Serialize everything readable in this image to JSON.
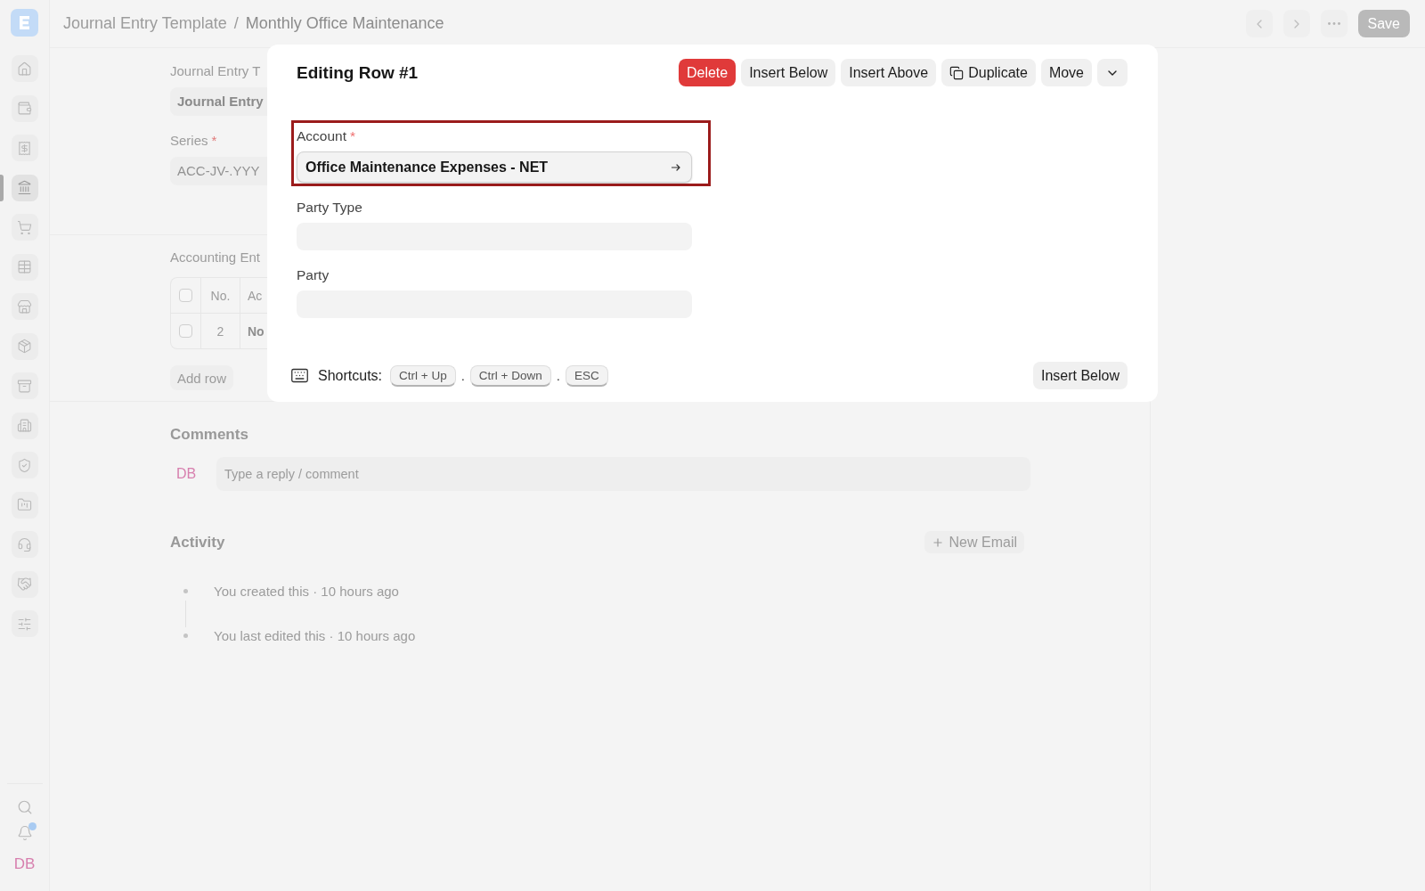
{
  "sidebar": {
    "items": [
      {
        "selected": false
      },
      {
        "selected": false
      },
      {
        "selected": false
      },
      {
        "selected": true
      },
      {
        "selected": false
      },
      {
        "selected": false
      },
      {
        "selected": false
      },
      {
        "selected": false
      },
      {
        "selected": false
      },
      {
        "selected": false
      },
      {
        "selected": false
      },
      {
        "selected": false
      },
      {
        "selected": false
      },
      {
        "selected": false
      },
      {
        "selected": false
      }
    ],
    "has_unread": true,
    "avatar": "DB"
  },
  "header": {
    "breadcrumbs": [
      "Journal Entry Template",
      "Monthly Office Maintenance"
    ],
    "separator": "/",
    "save": "Save"
  },
  "form": {
    "fields": [
      {
        "label": "Journal Entry T",
        "kind": "link",
        "value": "Journal Entry"
      },
      {
        "label": "Series",
        "required_mark": "*",
        "kind": "select",
        "value": "ACC-JV-.YYY"
      }
    ],
    "table": {
      "title": "Accounting Ent",
      "header_checked": false,
      "columns": [
        "No.",
        "Ac"
      ],
      "rows": [
        {
          "checked": false,
          "no": "2",
          "account": "No"
        }
      ]
    },
    "add_row": "Add row"
  },
  "comments": {
    "title": "Comments",
    "avatar": "DB",
    "placeholder": "Type a reply / comment"
  },
  "activity": {
    "title": "Activity",
    "new_email": "New Email",
    "items": [
      "You created this · 10 hours ago",
      "You last edited this · 10 hours ago"
    ]
  },
  "modal": {
    "title": "Editing Row #1",
    "actions": [
      {
        "kind": "danger",
        "label": "Delete"
      },
      {
        "kind": "default",
        "label": "Insert Below"
      },
      {
        "kind": "default",
        "label": "Insert Above"
      },
      {
        "kind": "copy",
        "label": "Duplicate"
      },
      {
        "kind": "default",
        "label": "Move"
      },
      {
        "kind": "dropdown"
      }
    ],
    "fields": [
      {
        "label": "Account",
        "required_mark": "*",
        "value": "Office Maintenance Expenses - NET",
        "highlighted": true,
        "focused": true
      },
      {
        "label": "Party Type",
        "highlighted": false,
        "focused": false
      },
      {
        "label": "Party",
        "highlighted": false,
        "focused": false
      }
    ],
    "shortcuts": {
      "label": "Shortcuts:",
      "items": [
        {
          "kind": "key",
          "text": "Ctrl + Up"
        },
        {
          "kind": "separator",
          "text": "."
        },
        {
          "kind": "key",
          "text": "Ctrl + Down"
        },
        {
          "kind": "separator",
          "text": "."
        },
        {
          "kind": "key",
          "text": "ESC"
        }
      ]
    },
    "footer_button": "Insert Below"
  }
}
